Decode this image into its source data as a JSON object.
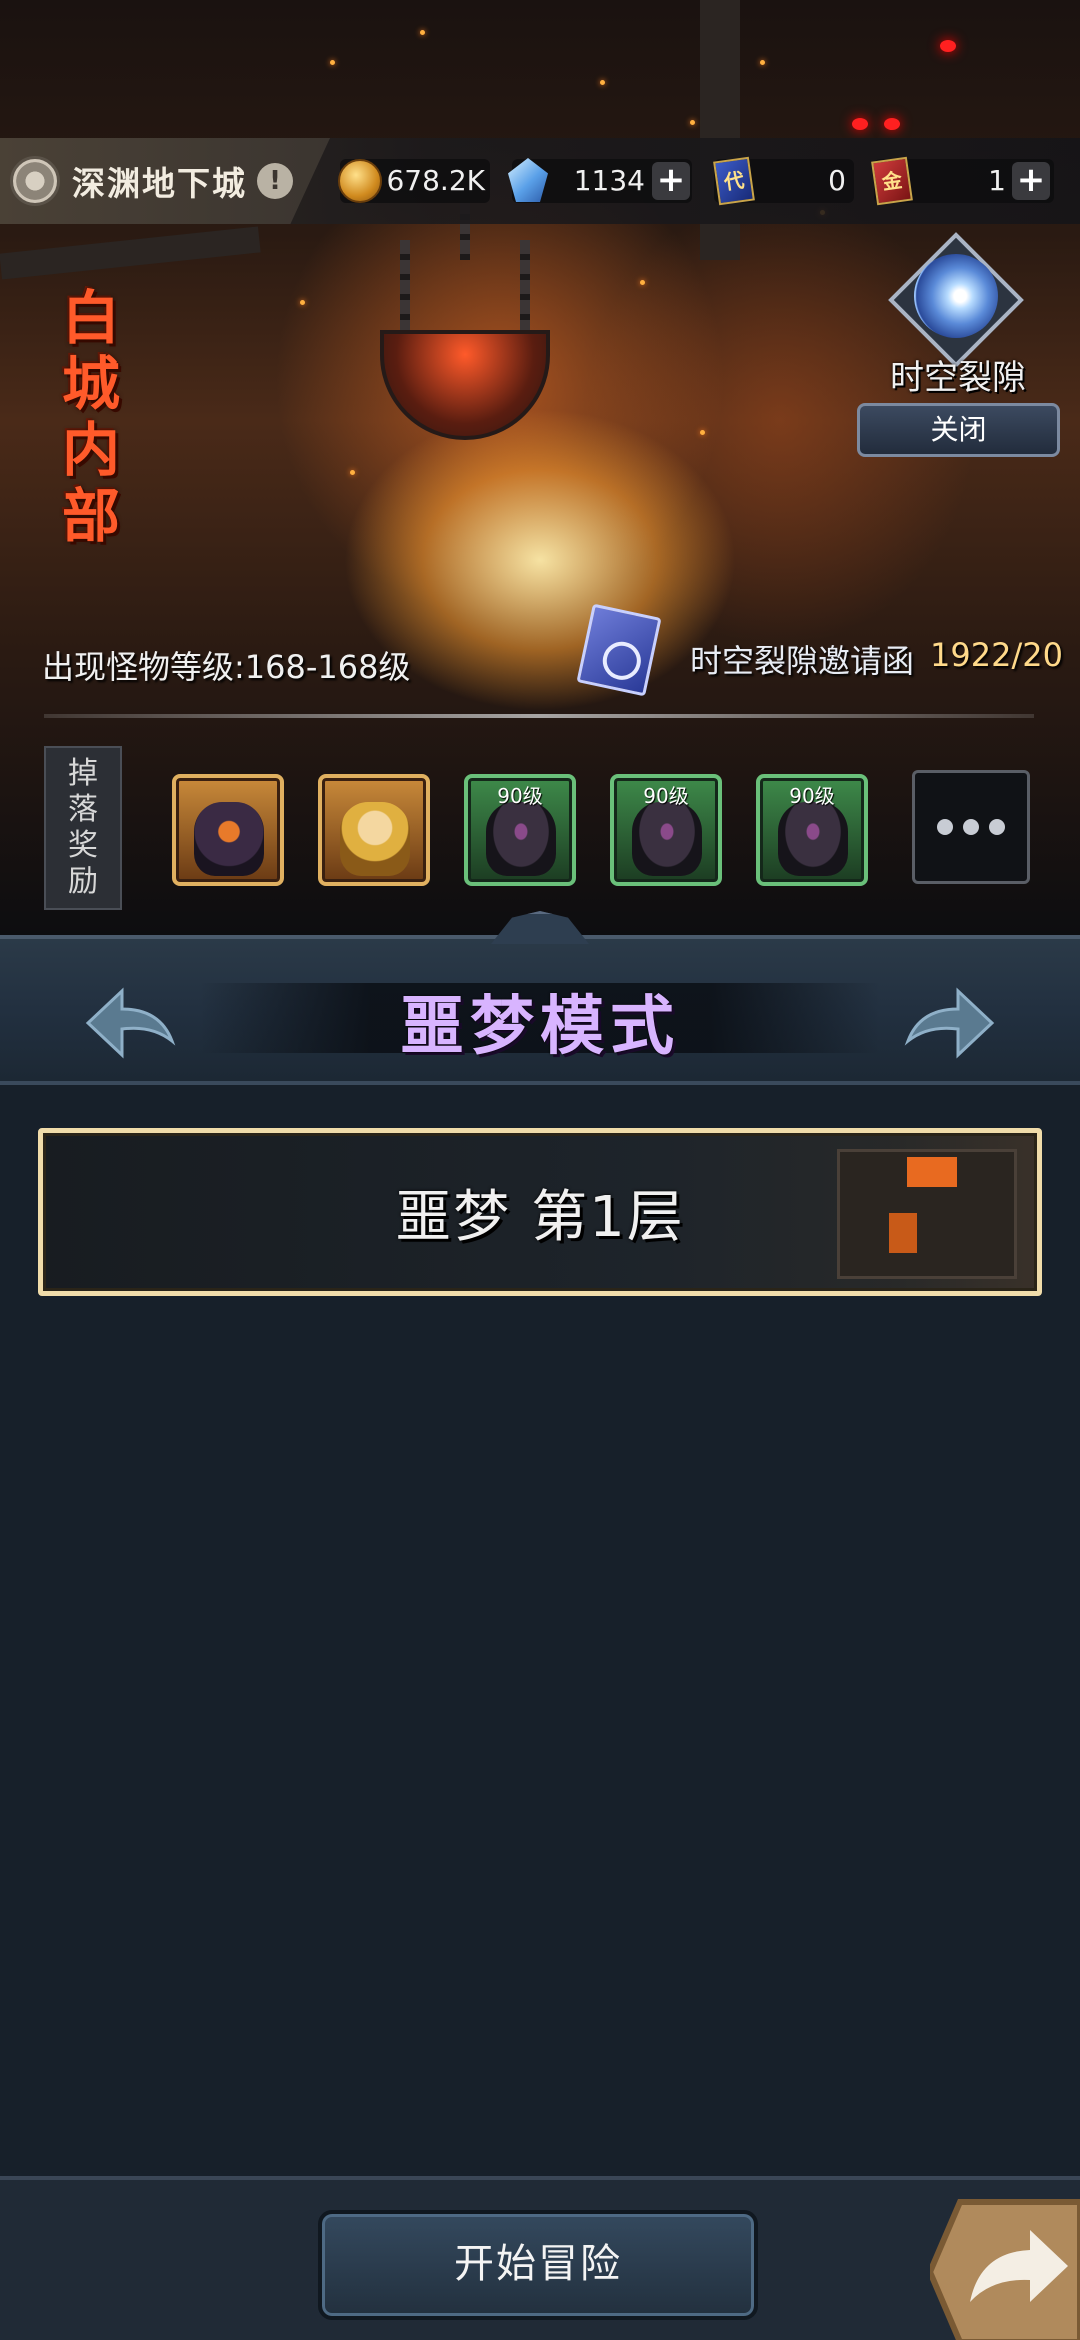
{
  "topbar": {
    "location": "深渊地下城",
    "gold": "678.2K",
    "crystals": "1134",
    "ticket_blue_glyph": "代",
    "ticket_blue_count": "0",
    "ticket_red_glyph": "金",
    "ticket_red_count": "1",
    "plus": "+"
  },
  "hero": {
    "dungeon_title": [
      "白",
      "城",
      "内",
      "部"
    ],
    "rift_label": "时空裂隙",
    "close_label": "关闭",
    "monster_level": "出现怪物等级:168-168级",
    "invite_label": "时空裂隙邀请函",
    "invite_count": "1922/20"
  },
  "drops": {
    "label": [
      "掉",
      "落",
      "奖",
      "励"
    ],
    "items": [
      {
        "level": "",
        "kind": "monster"
      },
      {
        "level": "",
        "kind": "elf"
      },
      {
        "level": "90级",
        "kind": "armor"
      },
      {
        "level": "90级",
        "kind": "armor"
      },
      {
        "level": "90级",
        "kind": "armor"
      }
    ]
  },
  "mode": {
    "title": "噩梦模式"
  },
  "floors": [
    {
      "label": "噩梦 第1层"
    }
  ],
  "bottom": {
    "start_label": "开始冒险"
  },
  "colors": {
    "mode_title": "#d8b4ff",
    "invite_count": "#ffd98a",
    "floor_border": "#f0dcaa"
  }
}
